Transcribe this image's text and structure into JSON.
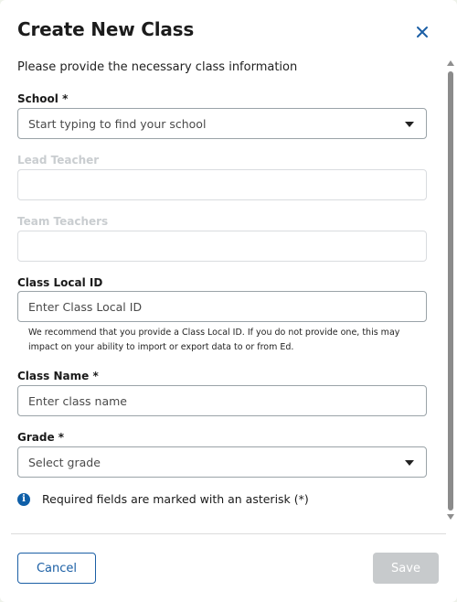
{
  "dialog": {
    "title": "Create New Class",
    "subtitle": "Please provide the necessary class information",
    "close_icon": "close-icon"
  },
  "fields": {
    "school": {
      "label": "School *",
      "placeholder": "Start typing to find your school"
    },
    "lead_teacher": {
      "label": "Lead Teacher",
      "value": ""
    },
    "team_teachers": {
      "label": "Team Teachers",
      "value": ""
    },
    "class_local_id": {
      "label": "Class Local ID",
      "placeholder": "Enter Class Local ID",
      "hint": "We recommend that you provide a Class Local ID. If you do not provide one, this may impact on your ability to import or export data to or from Ed."
    },
    "class_name": {
      "label": "Class Name *",
      "placeholder": "Enter class name"
    },
    "grade": {
      "label": "Grade *",
      "selected": "Select grade"
    }
  },
  "info": {
    "icon": "info-icon",
    "text": "Required fields are marked with an asterisk (*)"
  },
  "footer": {
    "cancel_label": "Cancel",
    "save_label": "Save"
  },
  "colors": {
    "primary": "#1b5fa5",
    "disabled_button": "#c7cacc",
    "info_icon": "#0f5fa8"
  }
}
